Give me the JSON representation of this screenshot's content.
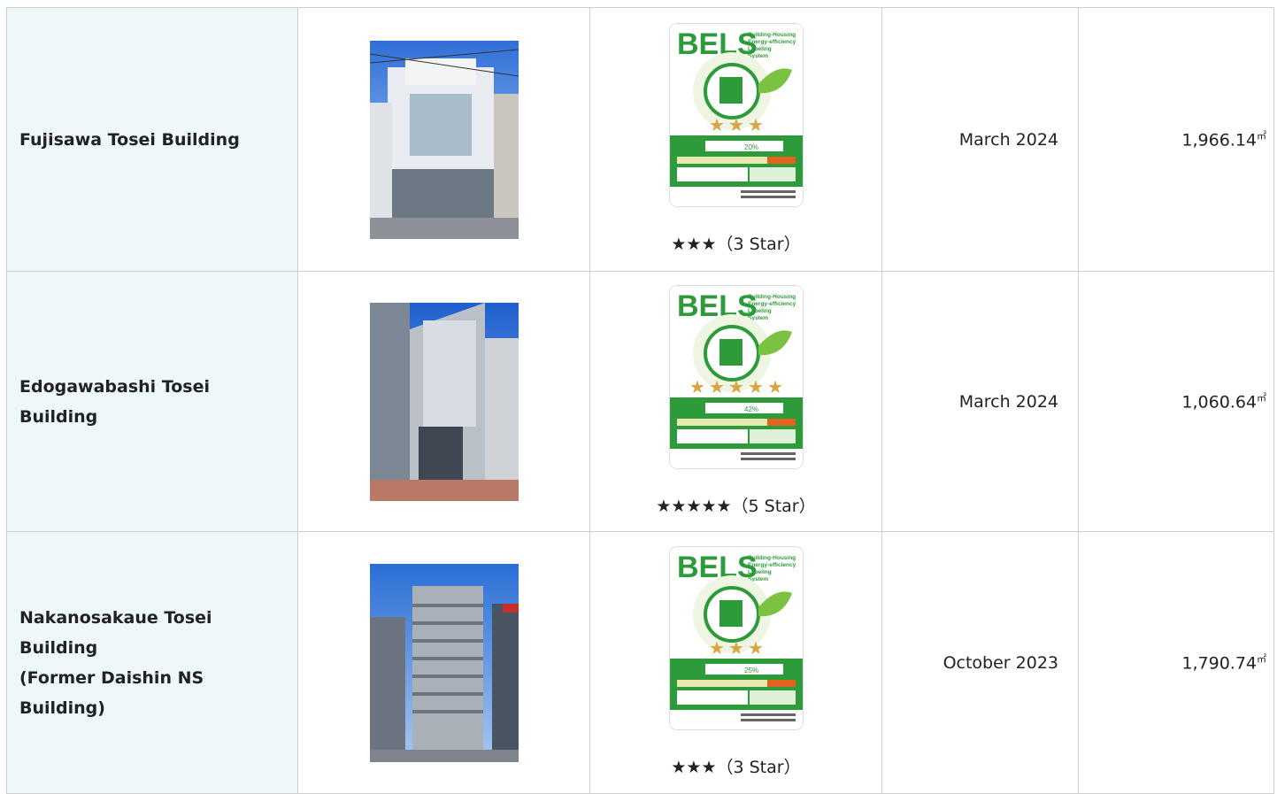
{
  "rows": [
    {
      "name": "Fujisawa Tosei Building",
      "stars": 3,
      "rating": "★★★（3 Star）",
      "label_pct": "20",
      "date": "March 2024",
      "area": "1,966.14",
      "area_unit": "㎡"
    },
    {
      "name": "Edogawabashi Tosei Building",
      "stars": 5,
      "rating": "★★★★★（5 Star）",
      "label_pct": "42",
      "date": "March 2024",
      "area": "1,060.64",
      "area_unit": "㎡"
    },
    {
      "name_lines": [
        "Nakanosakaue Tosei",
        "Building",
        "(Former Daishin NS",
        "Building)"
      ],
      "stars": 3,
      "rating": "★★★（3 Star）",
      "label_pct": "25",
      "date": "October 2023",
      "area": "1,790.74",
      "area_unit": "㎡"
    }
  ],
  "bels_logo": {
    "title": "BELS",
    "subtitle_lines": [
      "Building-Housing",
      "Energy-efficiency",
      "Labeling",
      "System"
    ]
  },
  "colors": {
    "name_cell_bg": "#eef8fb",
    "border": "#cfcfcf",
    "bels_green": "#2e9b3a"
  }
}
